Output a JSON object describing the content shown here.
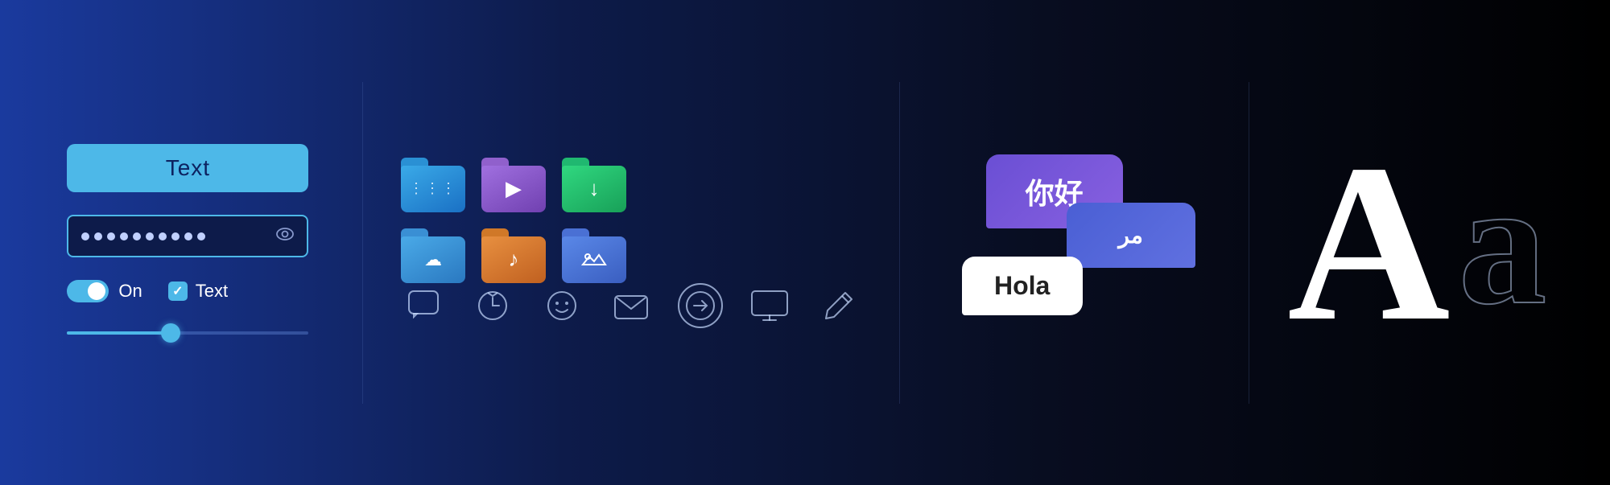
{
  "controls": {
    "text_input_label": "Text",
    "password_placeholder": "••••••••••",
    "toggle_label": "On",
    "checkbox_label": "Text",
    "slider_value": 43
  },
  "folders": [
    {
      "name": "files-folder",
      "color": "blue",
      "icon": "≡"
    },
    {
      "name": "video-folder",
      "color": "purple",
      "icon": "▶"
    },
    {
      "name": "download-folder",
      "color": "green",
      "icon": "↓"
    },
    {
      "name": "cloud-folder",
      "color": "cloud",
      "icon": "☁"
    },
    {
      "name": "music-folder",
      "color": "orange",
      "icon": "♪"
    },
    {
      "name": "photos-folder",
      "color": "photos",
      "icon": "⛰"
    }
  ],
  "translation": {
    "chinese": "你好",
    "arabic": "مر",
    "spanish": "Hola"
  },
  "system_icons": [
    {
      "name": "chat-icon",
      "symbol": "💬"
    },
    {
      "name": "clock-icon",
      "symbol": "⏰"
    },
    {
      "name": "emoji-icon",
      "symbol": "😊"
    },
    {
      "name": "mail-icon",
      "symbol": "✉"
    },
    {
      "name": "arrow-right-icon",
      "symbol": "→"
    },
    {
      "name": "monitor-icon",
      "symbol": "🖥"
    },
    {
      "name": "pen-icon",
      "symbol": "✏"
    }
  ],
  "typography": {
    "large_letter": "A",
    "small_letter": "a"
  }
}
